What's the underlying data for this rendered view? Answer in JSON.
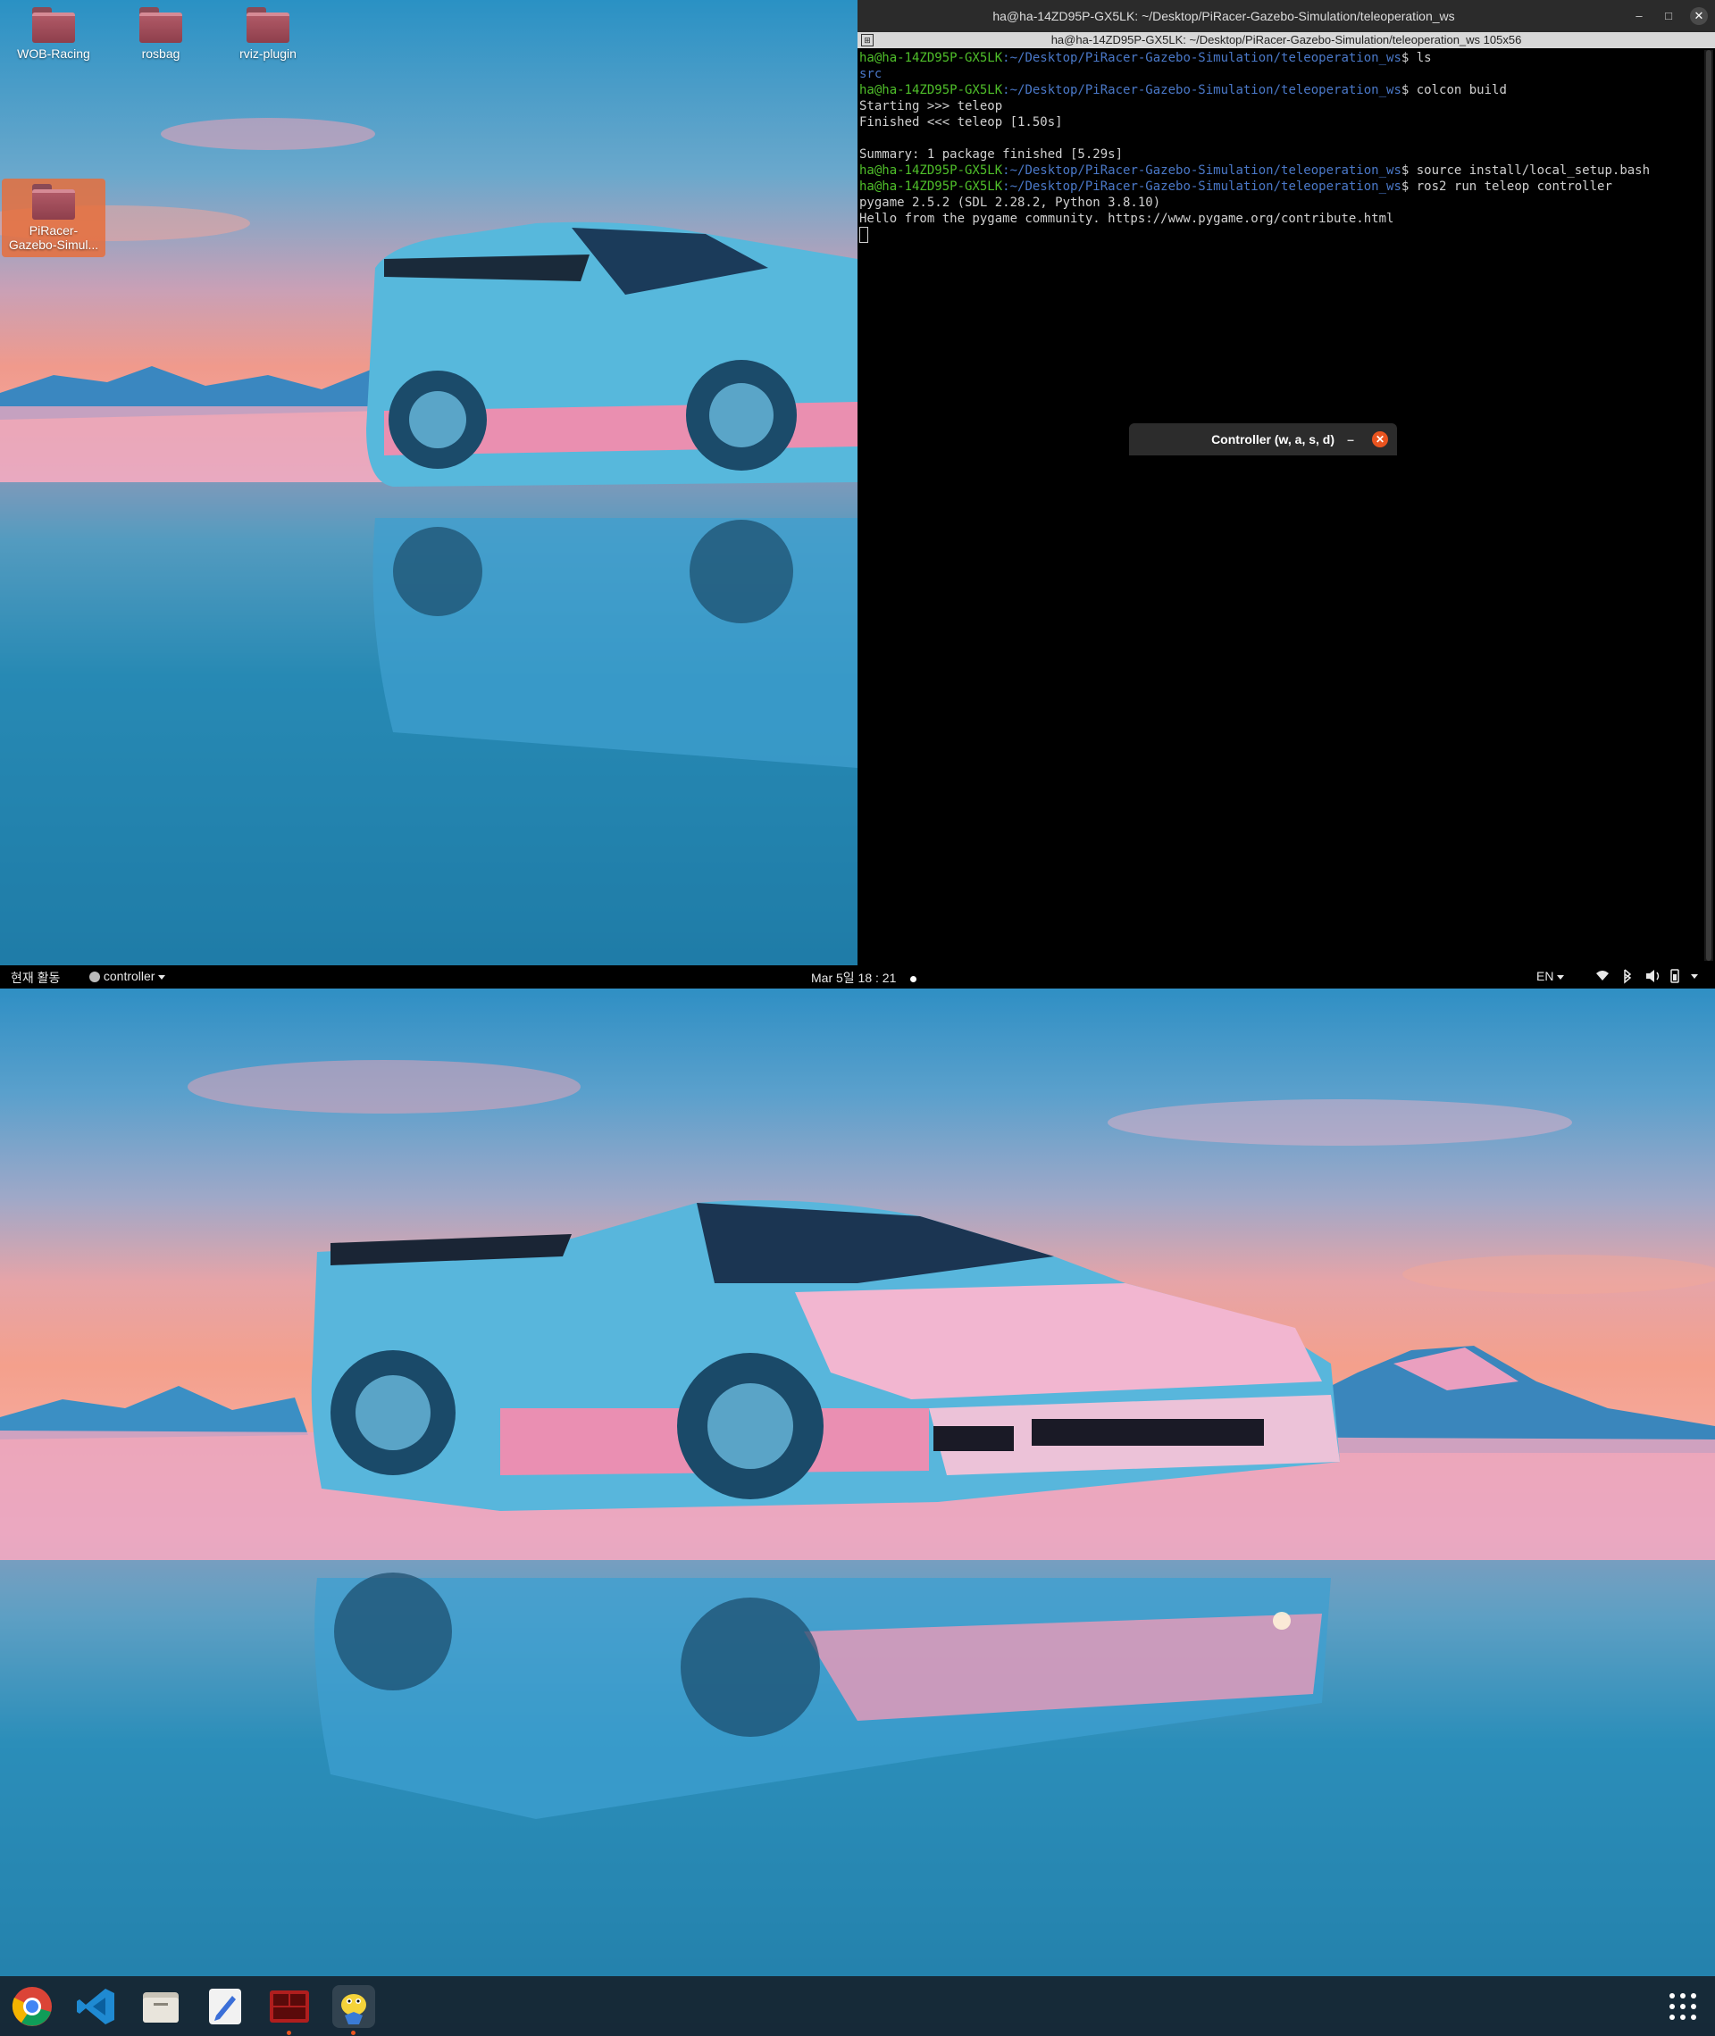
{
  "desktop": {
    "icons": [
      {
        "label": "WOB-Racing"
      },
      {
        "label": "rosbag"
      },
      {
        "label": "rviz-plugin"
      },
      {
        "label_line1": "PiRacer-",
        "label_line2": "Gazebo-Simul..."
      }
    ]
  },
  "terminal": {
    "title": "ha@ha-14ZD95P-GX5LK: ~/Desktop/PiRacer-Gazebo-Simulation/teleoperation_ws",
    "tab_label": "ha@ha-14ZD95P-GX5LK: ~/Desktop/PiRacer-Gazebo-Simulation/teleoperation_ws 105x56",
    "prompt_user": "ha@ha-14ZD95P-GX5LK",
    "prompt_path": ":~/Desktop/PiRacer-Gazebo-Simulation/teleoperation_ws",
    "lines": [
      {
        "type": "cmd",
        "text": "$ ls"
      },
      {
        "type": "out_blue",
        "text": "src"
      },
      {
        "type": "cmd",
        "text": "$ colcon build"
      },
      {
        "type": "out",
        "text": "Starting >>> teleop"
      },
      {
        "type": "out",
        "text": "Finished <<< teleop [1.50s]"
      },
      {
        "type": "out",
        "text": ""
      },
      {
        "type": "out",
        "text": "Summary: 1 package finished [5.29s]"
      },
      {
        "type": "cmd",
        "text": "$ source install/local_setup.bash"
      },
      {
        "type": "cmd",
        "text": "$ ros2 run teleop controller"
      },
      {
        "type": "out",
        "text": "pygame 2.5.2 (SDL 2.28.2, Python 3.8.10)"
      },
      {
        "type": "out",
        "text": "Hello from the pygame community. https://www.pygame.org/contribute.html"
      }
    ],
    "buttons": {
      "minimize": "–",
      "maximize": "□",
      "close": "✕"
    }
  },
  "controller_window": {
    "title": "Controller (w, a, s, d)",
    "minimize": "–",
    "close": "✕"
  },
  "topbar": {
    "activities": "현재 활동",
    "app_menu": "controller",
    "clock": "Mar 5일  18 : 21",
    "input_lang": "EN"
  },
  "dock": {
    "apps": [
      {
        "name": "chrome",
        "icon": "chrome-icon"
      },
      {
        "name": "vscode",
        "icon": "vscode-icon"
      },
      {
        "name": "files",
        "icon": "files-icon"
      },
      {
        "name": "text-editor",
        "icon": "text-editor-icon"
      },
      {
        "name": "terminator",
        "icon": "terminator-icon"
      },
      {
        "name": "pygame",
        "icon": "pygame-icon"
      }
    ],
    "show_apps_icon": "grid-icon"
  },
  "colors": {
    "accent": "#e9541f",
    "prompt_user": "#4fbf2a",
    "prompt_path": "#4a78c8"
  }
}
